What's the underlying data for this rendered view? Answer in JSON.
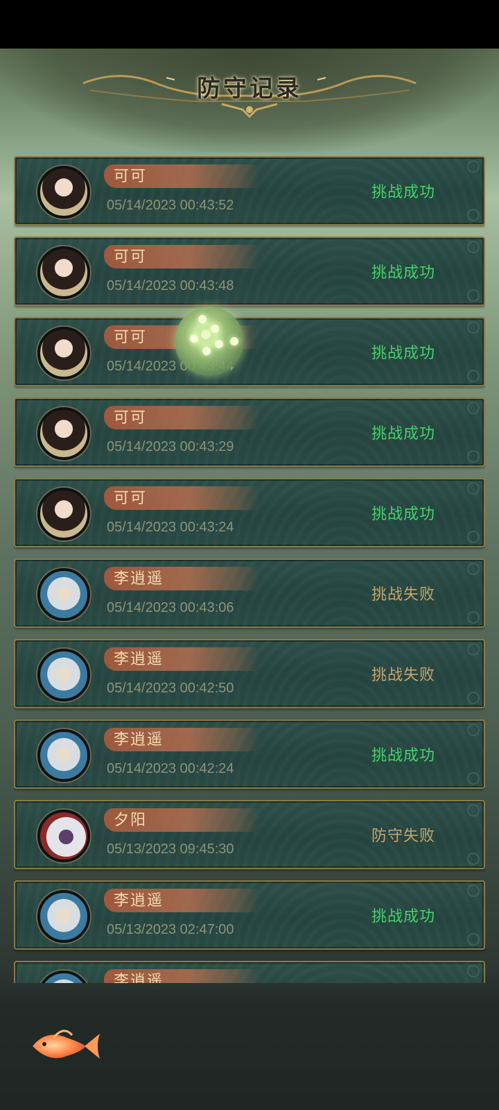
{
  "header": {
    "title": "防守记录"
  },
  "records": [
    {
      "name": "可可",
      "time": "05/14/2023 00:43:52",
      "result": "挑战成功",
      "status": "win",
      "avatar": "keke"
    },
    {
      "name": "可可",
      "time": "05/14/2023 00:43:48",
      "result": "挑战成功",
      "status": "win",
      "avatar": "keke"
    },
    {
      "name": "可可",
      "time": "05/14/2023 00:43:44",
      "result": "挑战成功",
      "status": "win",
      "avatar": "keke"
    },
    {
      "name": "可可",
      "time": "05/14/2023 00:43:29",
      "result": "挑战成功",
      "status": "win",
      "avatar": "keke"
    },
    {
      "name": "可可",
      "time": "05/14/2023 00:43:24",
      "result": "挑战成功",
      "status": "win",
      "avatar": "keke"
    },
    {
      "name": "李逍遥",
      "time": "05/14/2023 00:43:06",
      "result": "挑战失败",
      "status": "lose",
      "avatar": "li"
    },
    {
      "name": "李逍遥",
      "time": "05/14/2023 00:42:50",
      "result": "挑战失败",
      "status": "lose",
      "avatar": "li"
    },
    {
      "name": "李逍遥",
      "time": "05/14/2023 00:42:24",
      "result": "挑战成功",
      "status": "win",
      "avatar": "li"
    },
    {
      "name": "夕阳",
      "time": "05/13/2023 09:45:30",
      "result": "防守失败",
      "status": "lose",
      "avatar": "xi"
    },
    {
      "name": "李逍遥",
      "time": "05/13/2023 02:47:00",
      "result": "挑战成功",
      "status": "win",
      "avatar": "li"
    },
    {
      "name": "李逍遥",
      "time": "",
      "result": "",
      "status": "win",
      "avatar": "li"
    }
  ],
  "colors": {
    "win": "#45d36a",
    "lose": "#c8a56a"
  },
  "icons": {
    "floating_orb": "spirit-orb-icon",
    "bottom_left": "fish-icon"
  }
}
